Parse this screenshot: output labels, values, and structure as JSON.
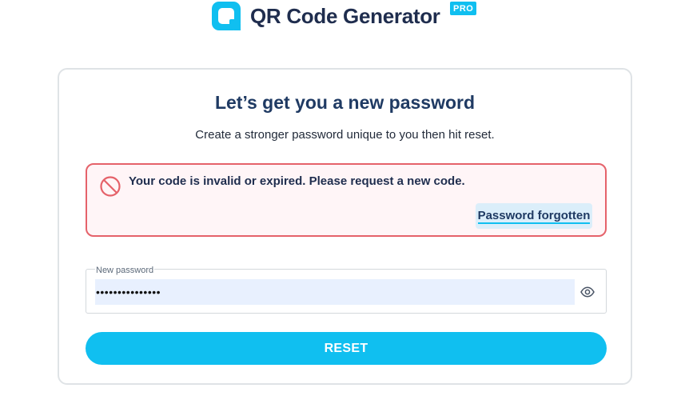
{
  "header": {
    "brand": "QR Code Generator",
    "badge": "PRO",
    "logo_icon": "qr-logo-icon"
  },
  "card": {
    "title": "Let’s get you a new password",
    "subtitle": "Create a stronger password unique to you then hit reset."
  },
  "alert": {
    "icon": "prohibited-icon",
    "message": "Your code is invalid or expired. Please request a new code.",
    "link_label": "Password forgotten"
  },
  "password_field": {
    "label": "New password",
    "value": "•••••••••••••••",
    "toggle_icon": "eye-icon"
  },
  "reset_label": "RESET",
  "colors": {
    "accent": "#10bff0",
    "text_dark": "#1f2d4e",
    "error_border": "#e5626a",
    "error_bg": "#fff5f7"
  }
}
